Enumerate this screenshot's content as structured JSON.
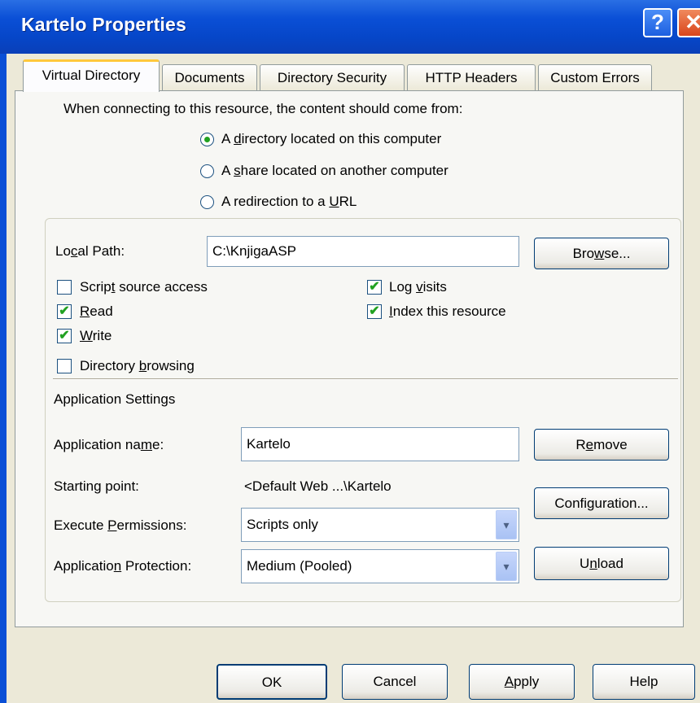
{
  "window": {
    "title": "Kartelo Properties",
    "help_glyph": "?",
    "close_glyph": "✕"
  },
  "tabs": [
    {
      "label": "Virtual Directory",
      "active": true
    },
    {
      "label": "Documents",
      "active": false
    },
    {
      "label": "Directory Security",
      "active": false
    },
    {
      "label": "HTTP Headers",
      "active": false
    },
    {
      "label": "Custom Errors",
      "active": false
    }
  ],
  "content_source": {
    "prompt": "When connecting to this resource, the content should come from:",
    "options": [
      {
        "label_pre": "A ",
        "label_key": "d",
        "label_post": "irectory located on this computer",
        "selected": true
      },
      {
        "label_pre": "A ",
        "label_key": "s",
        "label_post": "hare located on another computer",
        "selected": false
      },
      {
        "label_pre": "A redirection to a ",
        "label_key": "U",
        "label_post": "RL",
        "selected": false
      }
    ]
  },
  "local_path": {
    "label_pre": "Lo",
    "label_key": "c",
    "label_post": "al Path:",
    "value": "C:\\KnjigaASP",
    "browse_pre": "Bro",
    "browse_key": "w",
    "browse_post": "se..."
  },
  "permissions": {
    "script_source": {
      "label_pre": "Scrip",
      "label_key": "t",
      "label_post": " source access",
      "checked": false
    },
    "read": {
      "label_pre": "",
      "label_key": "R",
      "label_post": "ead",
      "checked": true
    },
    "write": {
      "label_pre": "",
      "label_key": "W",
      "label_post": "rite",
      "checked": true
    },
    "dir_browse": {
      "label_pre": "Directory ",
      "label_key": "b",
      "label_post": "rowsing",
      "checked": false
    },
    "log_visits": {
      "label_pre": "Log ",
      "label_key": "v",
      "label_post": "isits",
      "checked": true
    },
    "index": {
      "label_pre": "",
      "label_key": "I",
      "label_post": "ndex this resource",
      "checked": true
    },
    "check_glyph": "✔"
  },
  "app_settings": {
    "heading": "Application Settings",
    "name_label_pre": "Application na",
    "name_label_key": "m",
    "name_label_post": "e:",
    "name_value": "Kartelo",
    "remove_pre": "R",
    "remove_key": "e",
    "remove_post": "move",
    "starting_label": "Starting point:",
    "starting_value": "<Default Web ...\\Kartelo",
    "config_pre": "Confi",
    "config_key": "g",
    "config_post": "uration...",
    "exec_label_pre": "Execute ",
    "exec_label_key": "P",
    "exec_label_post": "ermissions:",
    "exec_value": "Scripts only",
    "prot_label_pre": "Applicatio",
    "prot_label_key": "n",
    "prot_label_post": " Protection:",
    "prot_value": "Medium (Pooled)",
    "unload_pre": "U",
    "unload_key": "n",
    "unload_post": "load",
    "dropdown_glyph": "▾"
  },
  "footer": {
    "ok": "OK",
    "cancel": "Cancel",
    "apply_key": "A",
    "apply_post": "pply",
    "help": "Help"
  }
}
